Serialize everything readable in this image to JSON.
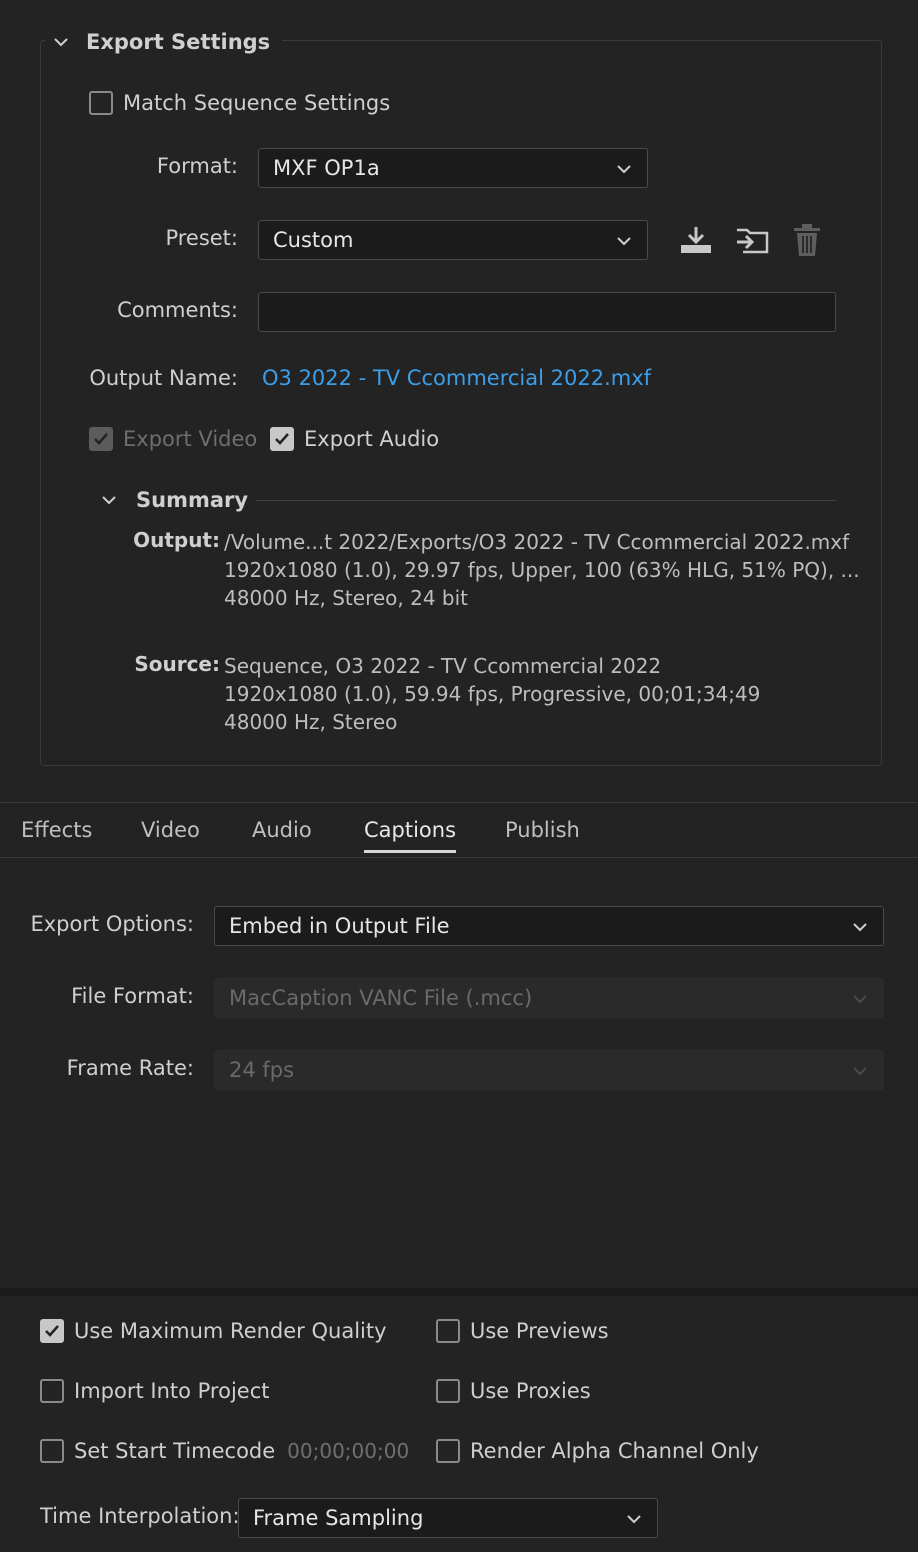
{
  "export_settings": {
    "title": "Export Settings",
    "match_sequence": {
      "label": "Match Sequence Settings",
      "checked": false
    },
    "format": {
      "label": "Format:",
      "value": "MXF OP1a"
    },
    "preset": {
      "label": "Preset:",
      "value": "Custom"
    },
    "comments": {
      "label": "Comments:",
      "value": ""
    },
    "output_name": {
      "label": "Output Name:",
      "value": "O3 2022 - TV Ccommercial 2022.mxf"
    },
    "export_video": {
      "label": "Export Video",
      "checked": true,
      "disabled": true
    },
    "export_audio": {
      "label": "Export Audio",
      "checked": true
    },
    "summary": {
      "title": "Summary",
      "output_label": "Output:",
      "output_lines": [
        "/Volume...t 2022/Exports/O3 2022 - TV Ccommercial 2022.mxf",
        "1920x1080 (1.0), 29.97 fps, Upper, 100 (63% HLG, 51% PQ), ...",
        "48000 Hz, Stereo, 24 bit"
      ],
      "source_label": "Source:",
      "source_lines": [
        "Sequence, O3 2022 - TV Ccommercial 2022",
        "1920x1080 (1.0), 59.94 fps, Progressive, 00;01;34;49",
        "48000 Hz, Stereo"
      ]
    },
    "icons": [
      "save-preset-icon",
      "import-preset-icon",
      "delete-preset-icon"
    ]
  },
  "tabs": [
    {
      "label": "Effects",
      "active": false
    },
    {
      "label": "Video",
      "active": false
    },
    {
      "label": "Audio",
      "active": false
    },
    {
      "label": "Captions",
      "active": true
    },
    {
      "label": "Publish",
      "active": false
    }
  ],
  "captions": {
    "export_options": {
      "label": "Export Options:",
      "value": "Embed in Output File"
    },
    "file_format": {
      "label": "File Format:",
      "value": "MacCaption VANC File (.mcc)",
      "disabled": true
    },
    "frame_rate": {
      "label": "Frame Rate:",
      "value": "24 fps",
      "disabled": true
    }
  },
  "bottom": {
    "use_max_render": {
      "label": "Use Maximum Render Quality",
      "checked": true
    },
    "use_previews": {
      "label": "Use Previews",
      "checked": false
    },
    "import_into_project": {
      "label": "Import Into Project",
      "checked": false
    },
    "use_proxies": {
      "label": "Use Proxies",
      "checked": false
    },
    "set_start_timecode": {
      "label": "Set Start Timecode",
      "checked": false,
      "timecode": "00;00;00;00"
    },
    "render_alpha": {
      "label": "Render Alpha Channel Only",
      "checked": false
    },
    "time_interpolation": {
      "label": "Time Interpolation:",
      "value": "Frame Sampling"
    }
  },
  "colors": {
    "background": "#232323",
    "link": "#3c9ee8",
    "accent_check": "#c8c8c8"
  }
}
